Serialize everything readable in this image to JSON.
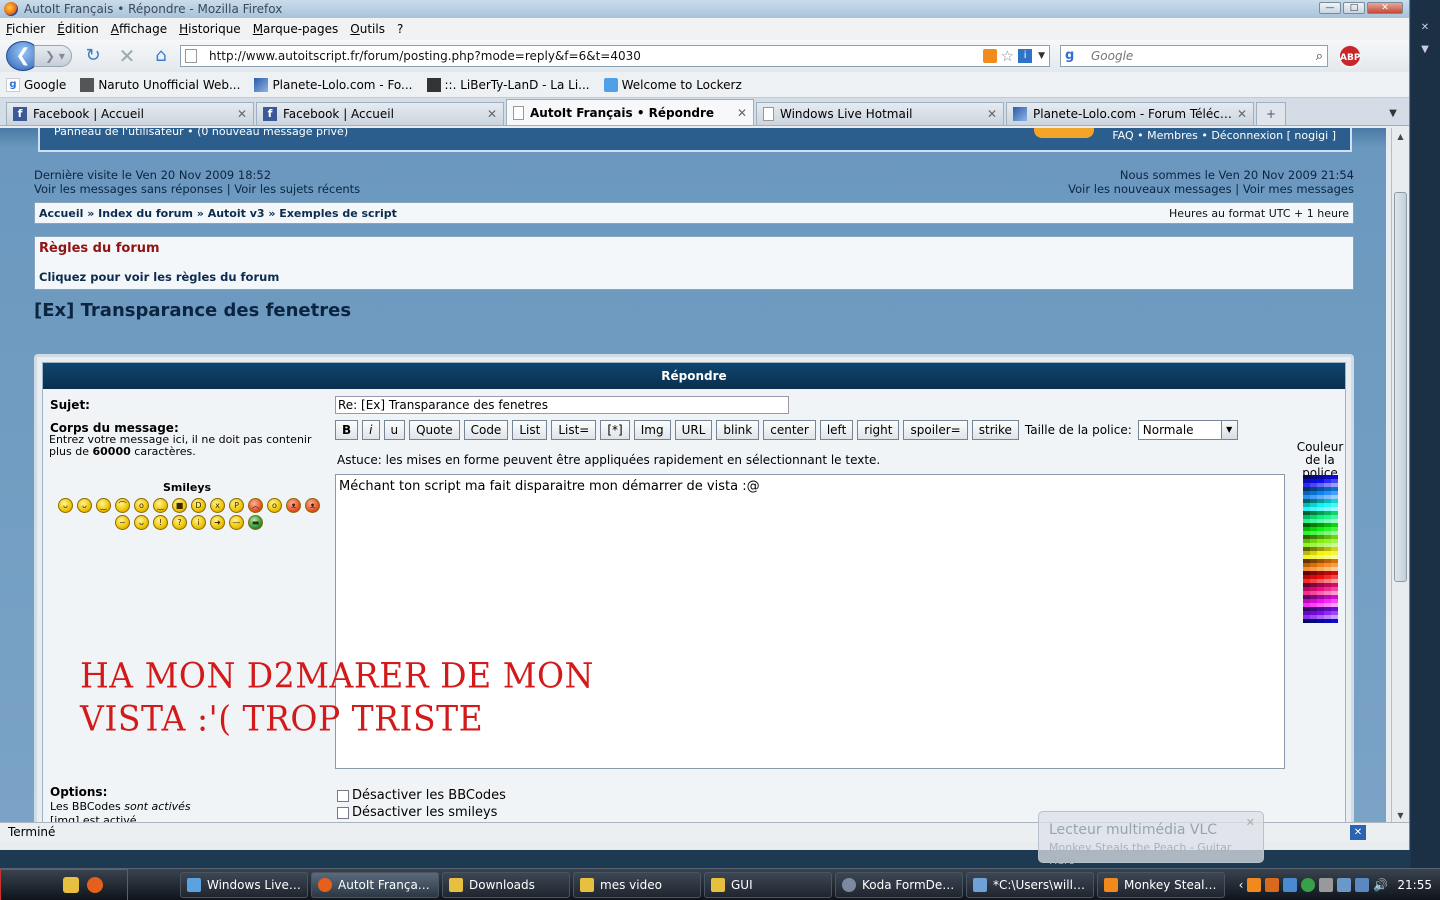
{
  "window": {
    "title": "AutoIt Français • Répondre - Mozilla Firefox",
    "controls": {
      "minimize": "—",
      "maximize": "□",
      "close": "✕"
    }
  },
  "menu": [
    "Fichier",
    "Édition",
    "Affichage",
    "Historique",
    "Marque-pages",
    "Outils",
    "?"
  ],
  "nav": {
    "url": "http://www.autoitscript.fr/forum/posting.php?mode=reply&f=6&t=4030",
    "search_placeholder": "Google",
    "abp_label": "ABP",
    "back_glyph": "❮",
    "forward_glyph": "❯ ▾",
    "reload_glyph": "↻",
    "stop_glyph": "✕",
    "home_glyph": "⌂"
  },
  "bookmarks": [
    {
      "label": "Google",
      "icon": "google-icon"
    },
    {
      "label": "Naruto Unofficial Web...",
      "icon": "naruto-icon"
    },
    {
      "label": "Planete-Lolo.com - Fo...",
      "icon": "planete-lolo-icon"
    },
    {
      "label": "::. LiBerTy-LanD - La Li...",
      "icon": "liberty-icon"
    },
    {
      "label": "Welcome to Lockerz",
      "icon": "lockerz-icon"
    }
  ],
  "tabs": [
    {
      "label": "Facebook | Accueil",
      "icon": "facebook-icon",
      "active": false
    },
    {
      "label": "Facebook | Accueil",
      "icon": "facebook-icon",
      "active": false
    },
    {
      "label": "AutoIt Français • Répondre",
      "icon": "page-icon",
      "active": true
    },
    {
      "label": "Windows Live Hotmail",
      "icon": "page-icon",
      "active": false
    },
    {
      "label": "Planete-Lolo.com - Forum Téléchar...",
      "icon": "planete-lolo-icon",
      "active": false
    }
  ],
  "forum": {
    "ucp_text": "Panneau de l'utilisateur • (0 nouveau message privé)",
    "header_links": "FAQ • Membres • Déconnexion [ nogigi ]",
    "last_visit": "Dernière visite le Ven 20 Nov 2009 18:52",
    "unanswered": "Voir les messages sans réponses | Voir les sujets récents",
    "now": "Nous sommes le Ven 20 Nov 2009 21:54",
    "new_msgs": "Voir les nouveaux messages | Voir mes messages",
    "breadcrumb": "Accueil » Index du forum » Autoit v3 » Exemples de script",
    "timezone": "Heures au format UTC + 1 heure",
    "rules_title": "Règles du forum",
    "rules_link": "Cliquez pour voir les règles du forum",
    "topic_title": "[Ex] Transparance des fenetres"
  },
  "reply": {
    "header": "Répondre",
    "subject_label": "Sujet:",
    "subject_value": "Re: [Ex] Transparance des fenetres",
    "body_label": "Corps du message:",
    "body_desc_1": "Entrez votre message ici, il ne doit pas contenir plus de",
    "body_desc_max": "60000",
    "body_desc_2": "caractères.",
    "smileys_title": "Smileys",
    "toolbar": [
      "B",
      "i",
      "u",
      "Quote",
      "Code",
      "List",
      "List=",
      "[*]",
      "Img",
      "URL",
      "blink",
      "center",
      "left",
      "right",
      "spoiler=",
      "strike"
    ],
    "font_size_label": "Taille de la police:",
    "font_size_value": "Normale",
    "tip": "Astuce: les mises en forme peuvent être appliquées rapidement en sélectionnant le texte.",
    "message": "Méchant ton script ma fait disparaitre mon démarrer de vista :@",
    "colors_label": "Couleur de la police",
    "options_label": "Options:",
    "bbcode_status_prefix": "Les BBCodes",
    "bbcode_status_suffix": "sont activés",
    "img_status": "[img] est activé",
    "disable_bbcode": "Désactiver les BBCodes",
    "disable_smileys": "Désactiver les smileys"
  },
  "overlay": {
    "line1": "HA MON D2MARER DE MON",
    "line2": "VISTA :'( TROP TRISTE"
  },
  "status": "Terminé",
  "vlc": {
    "title": "Lecteur multimédia VLC",
    "subtitle": "Monkey Steals the Peach - Guitar Hero",
    "close": "✕"
  },
  "taskbar": {
    "tasks": [
      {
        "label": "Windows Live ...",
        "active": false,
        "color": "#5aa2e0"
      },
      {
        "label": "AutoIt Françai...",
        "active": true,
        "color": "#e5601a"
      },
      {
        "label": "Downloads",
        "active": false,
        "color": "#e8c040"
      },
      {
        "label": "mes video",
        "active": false,
        "color": "#e8c040"
      },
      {
        "label": "GUI",
        "active": false,
        "color": "#e8c040"
      },
      {
        "label": "Koda FormDes...",
        "active": false,
        "color": "#7c8aa0"
      },
      {
        "label": "*C:\\Users\\willi...",
        "active": false,
        "color": "#6fa0d8"
      },
      {
        "label": "Monkey Steals...",
        "active": false,
        "color": "#f08a1c"
      }
    ],
    "clock": "21:55"
  },
  "colors": {
    "forum_red": "#8f1413",
    "panel_head": "#0f4670",
    "overlay_red": "#d21a1a"
  }
}
